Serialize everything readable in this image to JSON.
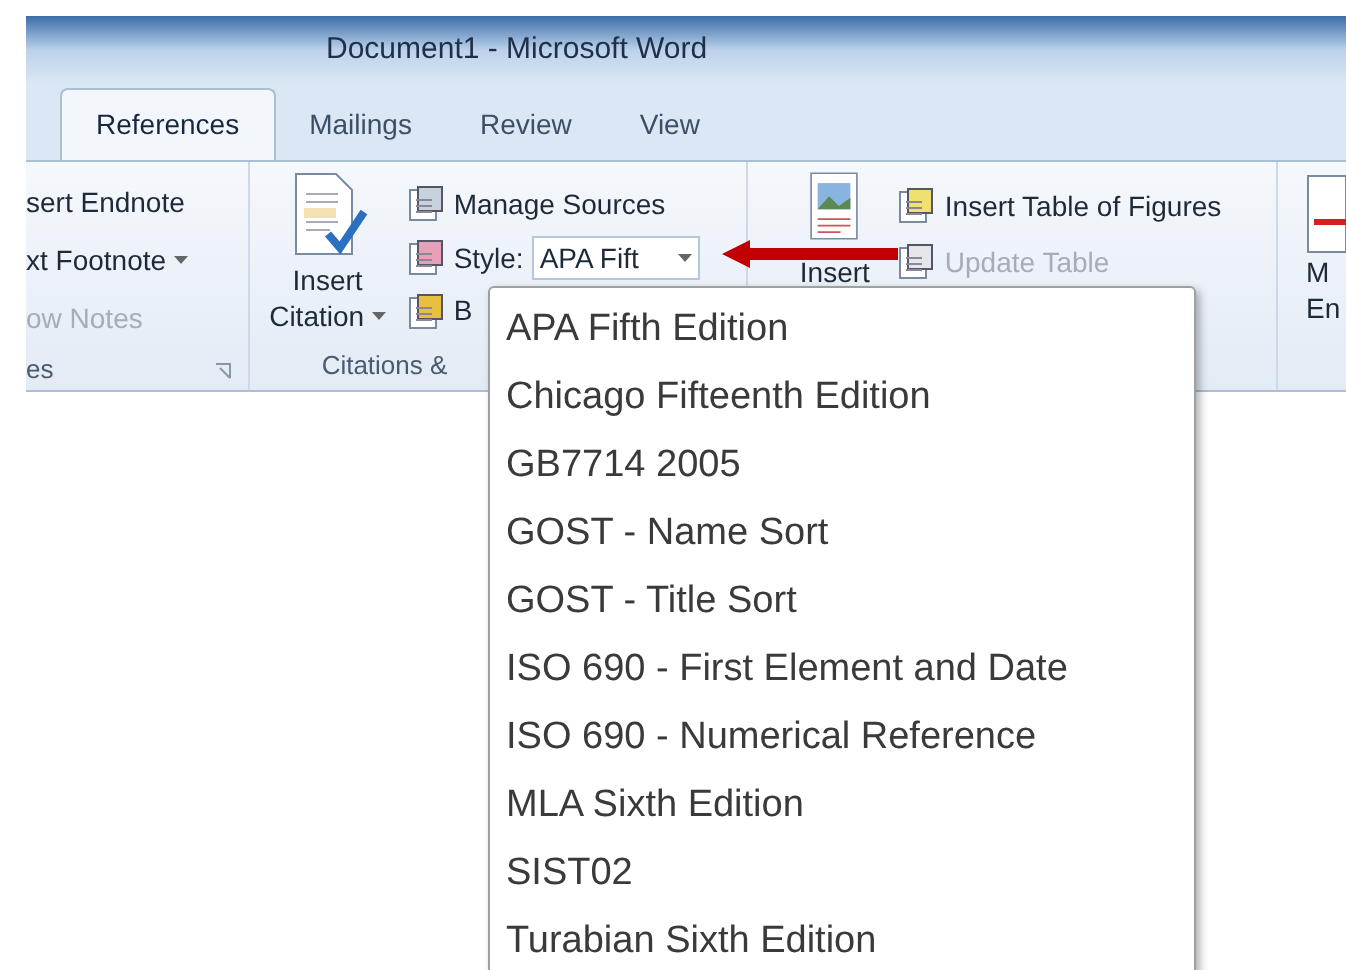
{
  "window": {
    "title": "Document1 - Microsoft Word"
  },
  "tabs": [
    {
      "label": "References",
      "selected": true
    },
    {
      "label": "Mailings",
      "selected": false
    },
    {
      "label": "Review",
      "selected": false
    },
    {
      "label": "View",
      "selected": false
    }
  ],
  "footnotes": {
    "items": [
      {
        "label": "sert Endnote",
        "disabled": false,
        "dropdown": false
      },
      {
        "label": "xt Footnote",
        "disabled": false,
        "dropdown": true
      },
      {
        "label": "ow Notes",
        "disabled": true,
        "dropdown": false
      }
    ],
    "label": "es"
  },
  "citations": {
    "insert_citation": [
      "Insert",
      "Citation"
    ],
    "manage_sources": "Manage Sources",
    "style_label": "Style:",
    "style_value": "APA Fift",
    "bibliography": "B",
    "label": "Citations &"
  },
  "captions": {
    "insert_caption": "Insert",
    "items": [
      {
        "label": "Insert Table of Figures",
        "disabled": false
      },
      {
        "label": "Update Table",
        "disabled": true
      }
    ]
  },
  "index": {
    "mark_entry": [
      "M",
      "En"
    ]
  },
  "style_menu": {
    "items": [
      "APA Fifth Edition",
      "Chicago Fifteenth Edition",
      "GB7714 2005",
      "GOST - Name Sort",
      "GOST - Title Sort",
      "ISO 690 - First Element and Date",
      "ISO 690 - Numerical Reference",
      "MLA Sixth Edition",
      "SIST02",
      "Turabian Sixth Edition"
    ]
  }
}
